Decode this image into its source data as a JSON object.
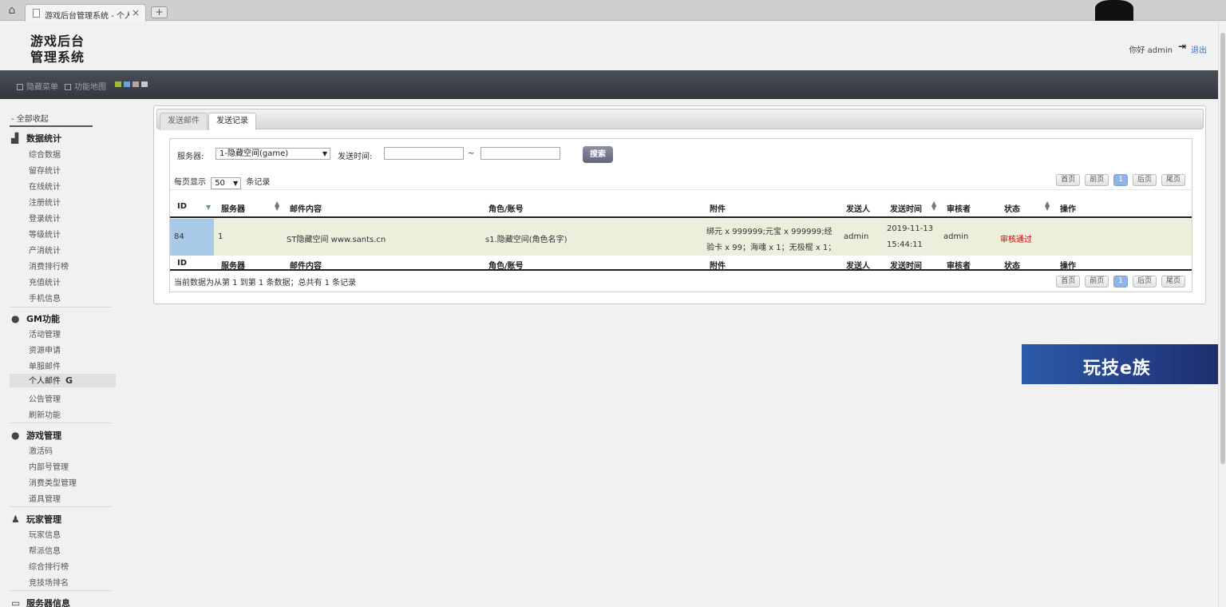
{
  "browser": {
    "tab_title": "游戏后台管理系统 - 个人",
    "close_glyph": "×",
    "new_tab_glyph": "+"
  },
  "header": {
    "logo_line1": "游戏后台",
    "logo_line2": "管理系统",
    "greeting": "你好 admin",
    "logout": "退出"
  },
  "navbar": {
    "hide_menu": "隐藏菜单",
    "function_map": "功能地图",
    "swatch_colors": [
      "#9dbb3c",
      "#6f9ed8",
      "#b9a2a2",
      "#c8c8c8"
    ]
  },
  "sidebar": {
    "collapse_all": "- 全部收起",
    "groups": [
      {
        "title": "数据统计",
        "items": [
          "综合数据",
          "留存统计",
          "在线统计",
          "注册统计",
          "登录统计",
          "等级统计",
          "产消统计",
          "消费排行榜",
          "充值统计",
          "手机信息"
        ]
      },
      {
        "title": "GM功能",
        "items": [
          "活动管理",
          "资源申请",
          "单服邮件",
          "个人邮件",
          "公告管理",
          "刷新功能"
        ]
      },
      {
        "title": "游戏管理",
        "items": [
          "激活码",
          "内部号管理",
          "消费类型管理",
          "道具管理"
        ]
      },
      {
        "title": "玩家管理",
        "items": [
          "玩家信息",
          "帮派信息",
          "综合排行榜",
          "竞技场排名"
        ]
      },
      {
        "title": "服务器信息",
        "items": []
      }
    ],
    "active_item": "个人邮件"
  },
  "panel": {
    "tabs": [
      {
        "label": "发送邮件"
      },
      {
        "label": "发送记录"
      }
    ],
    "filter": {
      "server_label": "服务器:",
      "server_value": "1-隐藏空间(game)",
      "time_label": "发送时间:",
      "time_sep": "~",
      "search_button": "搜索"
    },
    "per_page": {
      "prefix": "每页显示",
      "value": "50",
      "suffix": "条记录"
    },
    "pager": {
      "first": "首页",
      "prev": "前页",
      "current": "1",
      "next": "后页",
      "last": "尾页"
    },
    "columns": [
      "ID",
      "服务器",
      "邮件内容",
      "角色/账号",
      "附件",
      "发送人",
      "发送时间",
      "审核者",
      "状态",
      "操作"
    ],
    "rows": [
      {
        "id": "84",
        "server": "1",
        "content": "ST隐藏空间 www.sants.cn",
        "role": "s1.隐藏空间(角色名字)",
        "attachment_line1": "绑元 x 999999;元宝 x 999999;经",
        "attachment_line2": "验卡 x 99；海魂 x 1；无极棍 x 1；",
        "sender": "admin",
        "time_line1": "2019-11-13",
        "time_line2": "15:44:11",
        "reviewer": "admin",
        "status": "审核通过",
        "action": ""
      }
    ],
    "footer_info": "当前数据为从第 1 到第 1 条数据；总共有 1 条记录"
  },
  "banner": {
    "text": "玩技e族"
  }
}
